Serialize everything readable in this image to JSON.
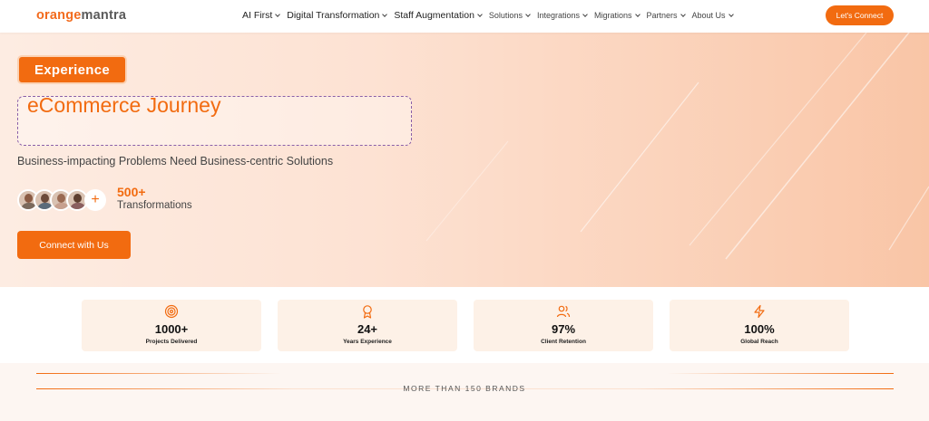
{
  "logo": {
    "part1": "orange",
    "part2": "mantra"
  },
  "nav": {
    "items": [
      {
        "label": "AI First"
      },
      {
        "label": "Digital Transformation"
      },
      {
        "label": "Staff Augmentation"
      },
      {
        "label": "Solutions"
      },
      {
        "label": "Integrations"
      },
      {
        "label": "Migrations"
      },
      {
        "label": "Partners"
      },
      {
        "label": "About Us"
      }
    ],
    "cta_label": "Let's Connect"
  },
  "hero": {
    "badge": "Experience",
    "title": "eCommerce Journey",
    "subtitle": "Business-impacting Problems Need Business-centric Solutions",
    "plus_symbol": "+",
    "stat_value": "500+",
    "stat_label": "Transformations",
    "button_label": "Connect with Us"
  },
  "stats": [
    {
      "value": "1000+",
      "label": "Projects Delivered",
      "icon": "target-icon"
    },
    {
      "value": "24+",
      "label": "Years Experience",
      "icon": "award-icon"
    },
    {
      "value": "97%",
      "label": "Client Retention",
      "icon": "users-icon"
    },
    {
      "value": "100%",
      "label": "Global Reach",
      "icon": "lightning-icon"
    }
  ],
  "brands": {
    "label": "MORE THAN 150 BRANDS"
  },
  "colors": {
    "accent": "#f26b10",
    "card_bg": "#fdf1e7",
    "hero_bg": "#fde2d3"
  }
}
